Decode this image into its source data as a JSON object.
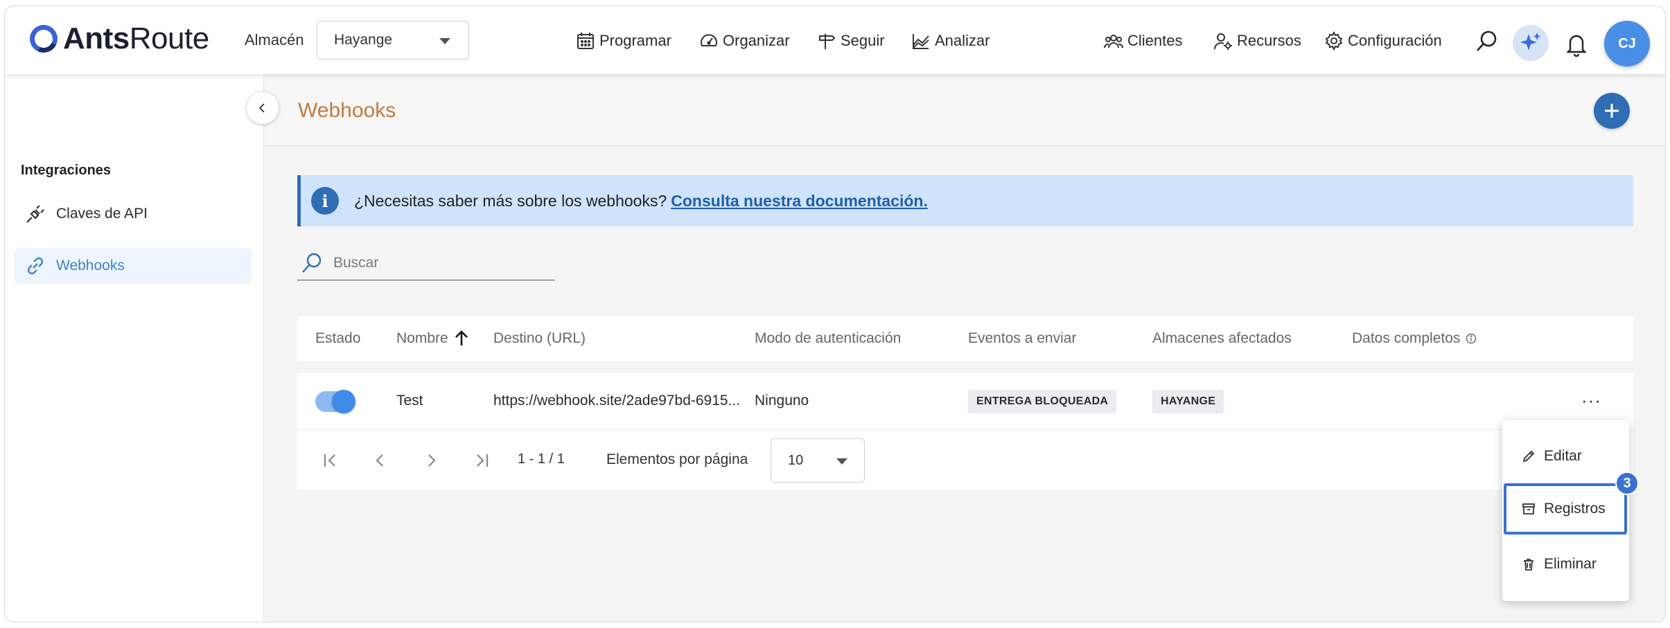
{
  "app": {
    "logo_text_bold": "Ants",
    "logo_text_light": "Route",
    "warehouse_label": "Almacén",
    "warehouse_value": "Hayange",
    "nav": [
      {
        "label": "Programar",
        "icon": "calendar-icon"
      },
      {
        "label": "Organizar",
        "icon": "gauge-icon"
      },
      {
        "label": "Seguir",
        "icon": "signpost-icon"
      },
      {
        "label": "Analizar",
        "icon": "chart-icon"
      },
      {
        "label": "Clientes",
        "icon": "clients-icon"
      },
      {
        "label": "Recursos",
        "icon": "resources-icon"
      },
      {
        "label": "Configuración",
        "icon": "gear-icon"
      }
    ],
    "avatar_initials": "CJ"
  },
  "sidebar": {
    "heading": "Integraciones",
    "items": [
      {
        "label": "Claves de API",
        "icon": "plug-icon",
        "active": false
      },
      {
        "label": "Webhooks",
        "icon": "link-icon",
        "active": true
      }
    ]
  },
  "page": {
    "title": "Webhooks",
    "info_text": "¿Necesitas saber más sobre los webhooks?",
    "info_link": "Consulta nuestra documentación.",
    "search_placeholder": "Buscar"
  },
  "table": {
    "columns": [
      "Estado",
      "Nombre",
      "Destino (URL)",
      "Modo de autenticación",
      "Eventos a enviar",
      "Almacenes afectados",
      "Datos completos"
    ],
    "rows": [
      {
        "enabled": true,
        "name": "Test",
        "url": "https://webhook.site/2ade97bd-6915...",
        "auth": "Ninguno",
        "events": "ENTREGA BLOQUEADA",
        "warehouses": "HAYANGE",
        "actions": "···"
      }
    ],
    "pagination": {
      "range": "1 - 1 / 1",
      "per_page_label": "Elementos por página",
      "per_page_value": "10"
    }
  },
  "context_menu": {
    "items": [
      {
        "label": "Editar",
        "icon": "pencil-icon"
      },
      {
        "label": "Registros",
        "icon": "archive-icon"
      },
      {
        "label": "Eliminar",
        "icon": "trash-icon"
      }
    ],
    "step_badge": "3"
  },
  "colors": {
    "accent": "#2f6db4",
    "title": "#c47a3f",
    "highlight": "#3a72cf",
    "banner": "#cfe3fa"
  }
}
